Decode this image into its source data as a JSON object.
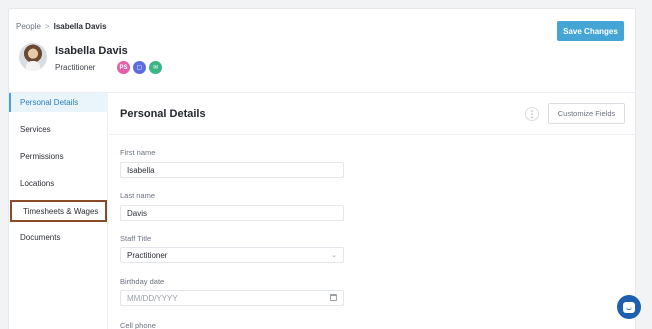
{
  "breadcrumb": {
    "parent": "People",
    "separator": ">",
    "current": "Isabella Davis"
  },
  "profile": {
    "name": "Isabella Davis",
    "role": "Practitioner",
    "badges": [
      {
        "icon": "person-icon",
        "text": "PS",
        "color": "#e35fa6"
      },
      {
        "icon": "calendar-icon",
        "text": "▢",
        "color": "#5c6ce0"
      },
      {
        "icon": "mail-icon",
        "text": "✉",
        "color": "#3bb486"
      }
    ]
  },
  "header": {
    "save_label": "Save Changes"
  },
  "sidebar": {
    "items": [
      {
        "label": "Personal Details",
        "active": true
      },
      {
        "label": "Services"
      },
      {
        "label": "Permissions"
      },
      {
        "label": "Locations"
      },
      {
        "label": "Timesheets & Wages",
        "focused": true
      },
      {
        "label": "Documents"
      }
    ]
  },
  "main": {
    "title": "Personal Details",
    "more_icon": "⋮",
    "customize_label": "Customize Fields",
    "fields": {
      "first_name": {
        "label": "First name",
        "value": "Isabella"
      },
      "last_name": {
        "label": "Last name",
        "value": "Davis"
      },
      "staff_title": {
        "label": "Staff Title",
        "value": "Practitioner",
        "chevron": "⌄"
      },
      "birthday": {
        "label": "Birthday date",
        "placeholder": "MM/DD/YYYY"
      },
      "cell_phone": {
        "label": "Cell phone"
      }
    }
  },
  "colors": {
    "accent": "#45a6d6",
    "chat": "#1f5fb0"
  }
}
